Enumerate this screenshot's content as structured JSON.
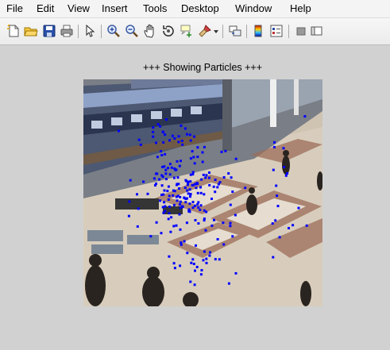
{
  "menubar": {
    "items": [
      "File",
      "Edit",
      "View",
      "Insert",
      "Tools",
      "Desktop",
      "Window",
      "Help"
    ]
  },
  "toolbar": {
    "icons": [
      "new-figure-icon",
      "open-file-icon",
      "save-icon",
      "print-icon",
      "select-arrow-icon",
      "zoom-in-icon",
      "zoom-out-icon",
      "pan-hand-icon",
      "rotate-3d-icon",
      "data-cursor-icon",
      "brush-icon",
      "brush-dropdown-icon",
      "link-plot-icon",
      "insert-colorbar-icon",
      "insert-legend-icon",
      "hide-plot-tools-icon",
      "show-plot-tools-icon"
    ]
  },
  "figure": {
    "title": "+++ Showing Particles +++",
    "image": "surveillance-frame-station-concourse",
    "particle_color": "#0000ff"
  }
}
